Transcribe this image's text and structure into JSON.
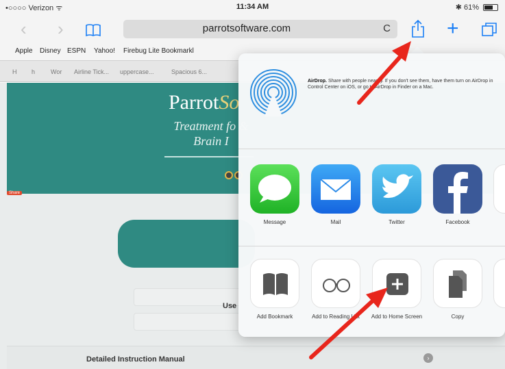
{
  "status_bar": {
    "carrier": "•○○○○ Verizon ᯤ",
    "time": "11:34 AM",
    "battery": "✱ 61%"
  },
  "toolbar": {
    "url": "parrotsoftware.com",
    "reload_glyph": "C",
    "back_glyph": "‹",
    "forward_glyph": "›",
    "new_tab_glyph": "+"
  },
  "bookmarks": [
    "Apple",
    "Disney",
    "ESPN",
    "Yahoo!",
    "Firebug Lite Bookmarkl"
  ],
  "tabs": [
    "H",
    "h",
    "Wor",
    "Airline Tick...",
    "uppercase...",
    "Spacious 6..."
  ],
  "page": {
    "title_main": "Parrot",
    "title_accent": "So",
    "tagline": "Treatment fo & Brain I",
    "share_label": "Share",
    "user_label": "Use",
    "manual_label": "Detailed Instruction Manual",
    "manual_chevron": "›"
  },
  "share_sheet": {
    "airdrop_bold": "AirDrop.",
    "airdrop_text": " Share with people nearby. If you don't see them, have them turn on AirDrop in Control Center on iOS, or go to AirDrop in Finder on a Mac.",
    "apps": [
      {
        "label": "Message",
        "icon": "message-icon"
      },
      {
        "label": "Mail",
        "icon": "mail-icon"
      },
      {
        "label": "Twitter",
        "icon": "twitter-icon"
      },
      {
        "label": "Facebook",
        "icon": "facebook-icon"
      }
    ],
    "actions": [
      {
        "label": "Add Bookmark",
        "icon": "book-icon"
      },
      {
        "label": "Add to Reading List",
        "icon": "glasses-icon"
      },
      {
        "label": "Add to Home Screen",
        "icon": "plus-icon"
      },
      {
        "label": "Copy",
        "icon": "copy-icon"
      }
    ]
  },
  "colors": {
    "accent": "#1a7ef5",
    "teal": "#2f8a82",
    "annotation_arrow": "#e8261c"
  }
}
